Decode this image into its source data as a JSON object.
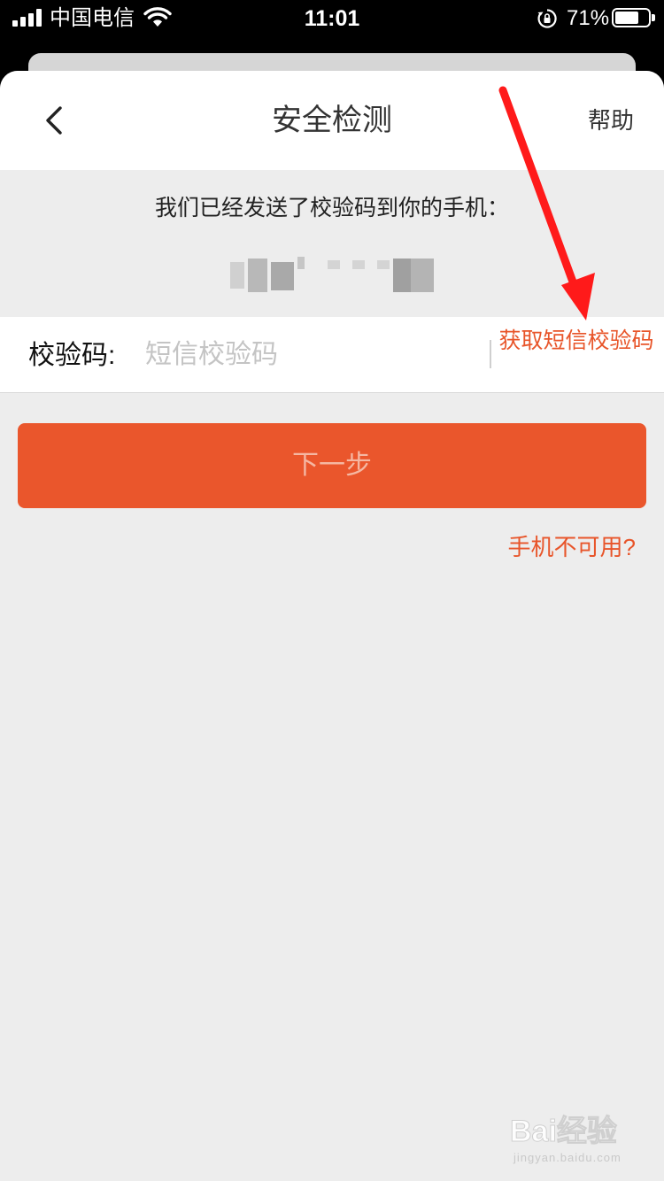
{
  "status_bar": {
    "carrier": "中国电信",
    "time": "11:01",
    "battery_percent": "71%",
    "battery_level": 0.71
  },
  "nav": {
    "title": "安全检测",
    "help_label": "帮助",
    "back_icon": "chevron-left-icon"
  },
  "verification": {
    "sent_message": "我们已经发送了校验码到你的手机："
  },
  "code_field": {
    "label": "校验码:",
    "placeholder": "短信校验码",
    "value": "",
    "get_code_label": "获取短信校验码"
  },
  "actions": {
    "next_label": "下一步",
    "phone_unavailable_label": "手机不可用?"
  },
  "annotation": {
    "arrow_color": "#ff1a1a"
  },
  "watermark": {
    "brand": "Bai经验",
    "url": "jingyan.baidu.com"
  },
  "colors": {
    "accent": "#ea562c",
    "link": "#e8552a",
    "background": "#ededed"
  }
}
